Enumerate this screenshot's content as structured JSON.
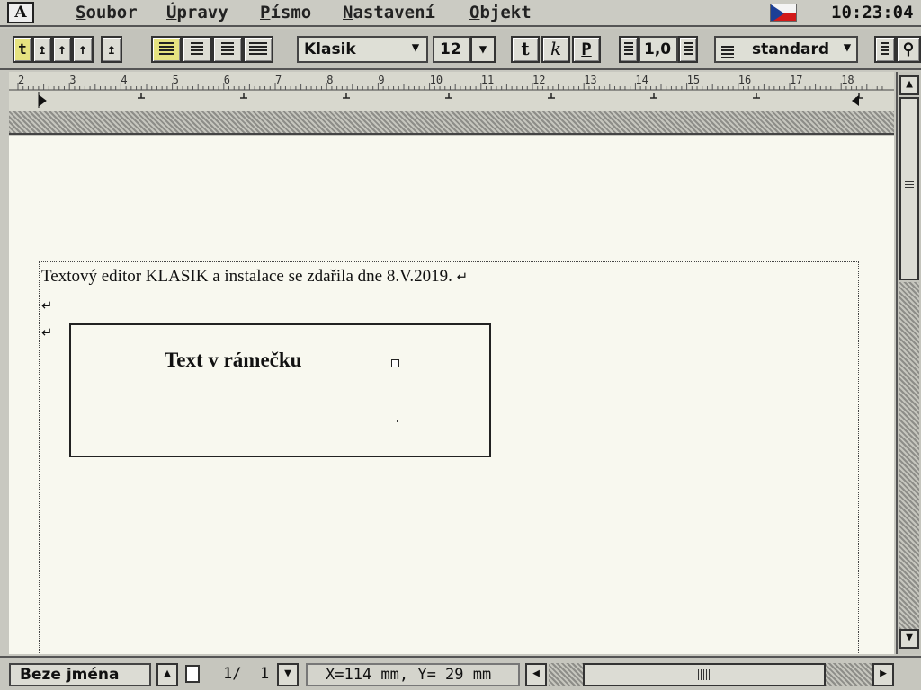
{
  "menubar": {
    "logo": "A",
    "items": [
      "Soubor",
      "Úpravy",
      "Písmo",
      "Nastavení",
      "Objekt"
    ],
    "clock": "10:23:04",
    "flag": "czech-flag-icon"
  },
  "toolbar": {
    "indent_buttons": [
      "t",
      "↥",
      "↑",
      "↑",
      "↥"
    ],
    "font_name": "Klasik",
    "font_size": "12",
    "style_bold": "t",
    "style_italic": "k",
    "style_underline": "P",
    "line_spacing": "1,0",
    "paragraph_style": "standard",
    "active_color": "#e6e380"
  },
  "ruler": {
    "labels": [
      "2",
      "3",
      "4",
      "5",
      "6",
      "7",
      "8",
      "9",
      "10",
      "11",
      "12",
      "13",
      "14",
      "15",
      "16",
      "17",
      "18"
    ]
  },
  "document": {
    "paragraph1": "Textový editor KLASIK a instalace se zdařila dne 8.V.2019.",
    "return_mark": "↵",
    "textbox_text": "Text v rámečku"
  },
  "statusbar": {
    "doc_name": "Beze jména",
    "page_current": "1/",
    "page_total": "1",
    "coords": "X=114 mm, Y= 29 mm"
  }
}
